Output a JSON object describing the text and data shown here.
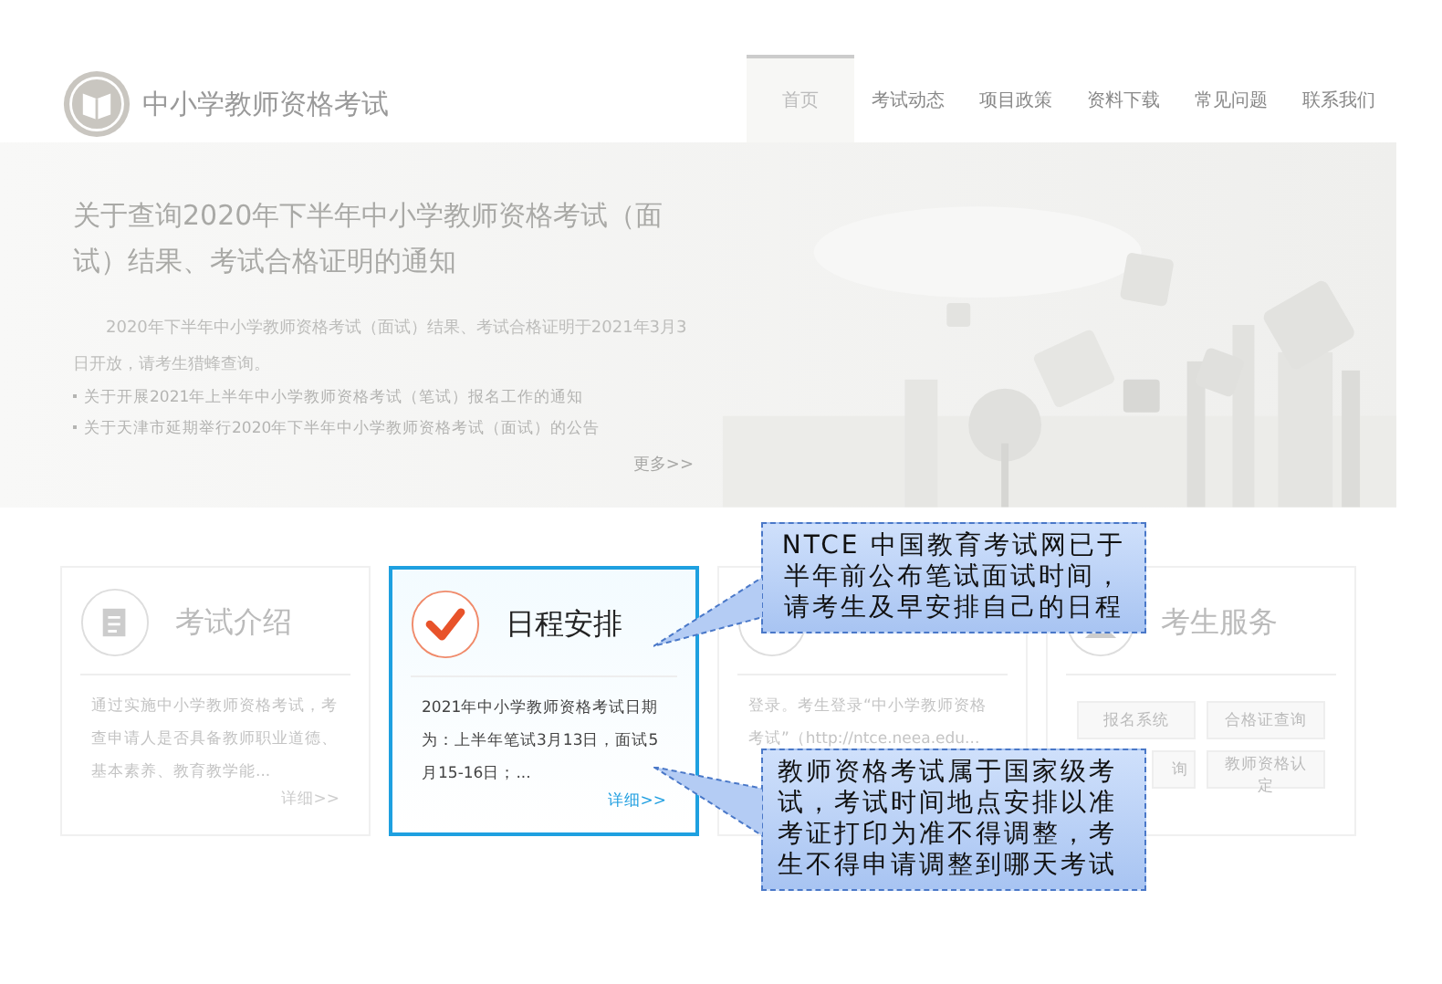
{
  "header": {
    "site_title": "中小学教师资格考试",
    "nav": [
      {
        "label": "首页",
        "selected": true
      },
      {
        "label": "考试动态",
        "selected": false
      },
      {
        "label": "项目政策",
        "selected": false
      },
      {
        "label": "资料下载",
        "selected": false
      },
      {
        "label": "常见问题",
        "selected": false
      },
      {
        "label": "联系我们",
        "selected": false
      }
    ]
  },
  "banner": {
    "headline": "关于查询2020年下半年中小学教师资格考试（面试）结果、考试合格证明的通知",
    "summary": "2020年下半年中小学教师资格考试（面试）结果、考试合格证明于2021年3月3日开放，请考生猎蜂查询。",
    "links": [
      "关于开展2021年上半年中小学教师资格考试（笔试）报名工作的通知",
      "关于天津市延期举行2020年下半年中小学教师资格考试（面试）的公告"
    ],
    "more": "更多>>"
  },
  "cards": [
    {
      "kind": "intro",
      "title": "考试介绍",
      "selected": false,
      "text": "通过实施中小学教师资格考试，考查申请人是否具备教师职业道德、基本素养、教育教学能...",
      "more": "详细>>"
    },
    {
      "kind": "schedule",
      "title": "日程安排",
      "selected": true,
      "text": "2021年中小学教师资格考试日期为：上半年笔试3月13日，面试5月15-16日；...",
      "more": "详细>>"
    },
    {
      "kind": "login",
      "selected": false,
      "text": "登录。考生登录“中小学教师资格考试”（http://ntce.neea.edu..."
    },
    {
      "kind": "services",
      "title": "考生服务",
      "selected": false,
      "buttons": [
        "报名系统",
        "合格证查询",
        "询",
        "教师资格认定"
      ]
    }
  ],
  "callouts": [
    "NTCE 中国教育考试网已于半年前公布笔试面试时间，请考生及早安排自己的日程",
    "教师资格考试属于国家级考试，考试时间地点安排以准考证打印为准不得调整，考生不得申请调整到哪天考试"
  ]
}
